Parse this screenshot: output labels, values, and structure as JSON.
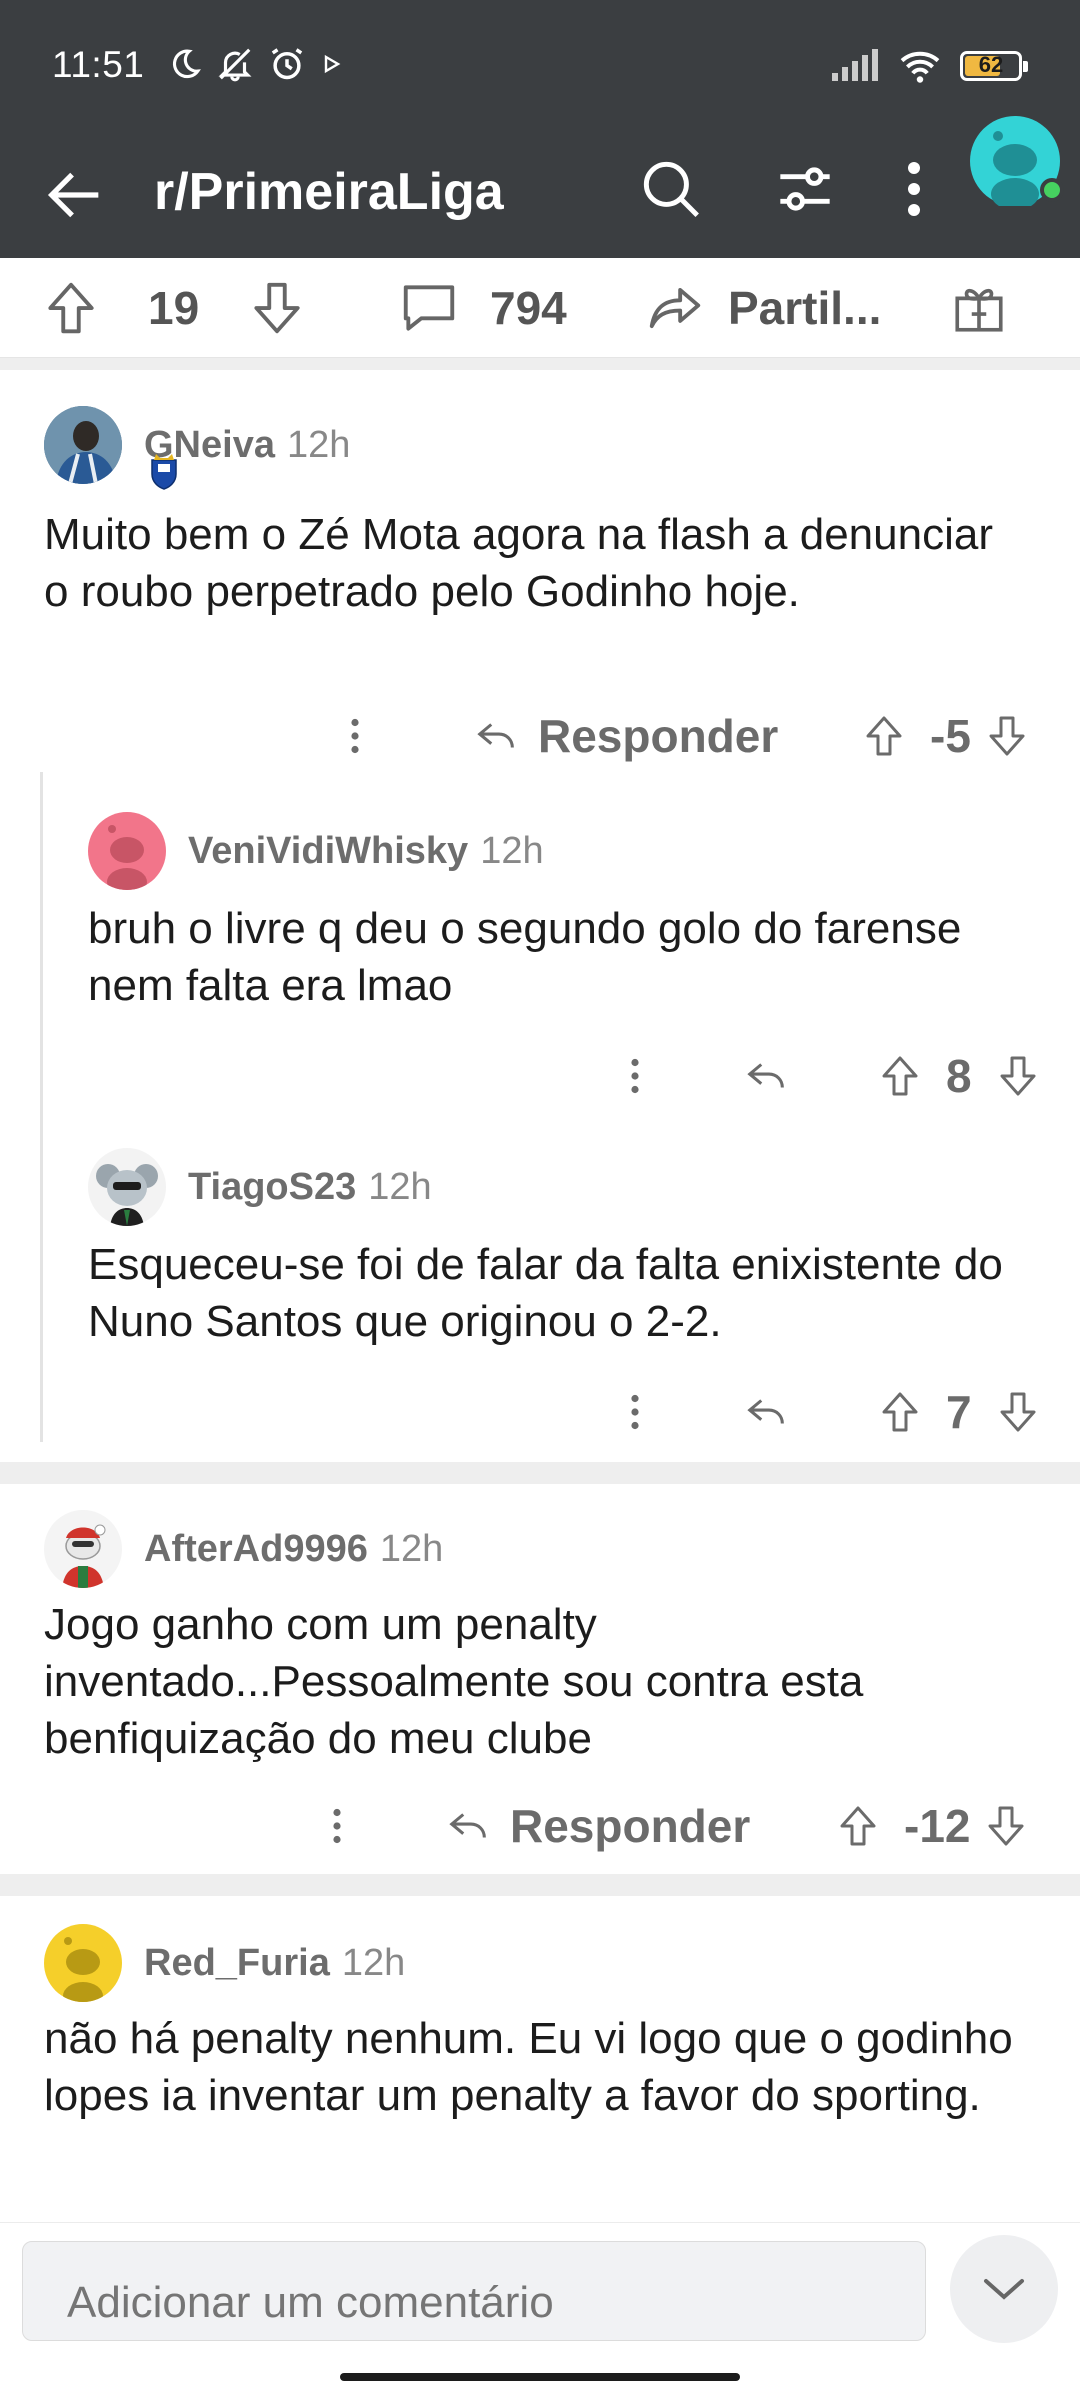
{
  "status_bar": {
    "time": "11:51",
    "battery_level": "62",
    "icons": [
      "moon-icon",
      "bell-off-icon",
      "alarm-icon",
      "play-icon",
      "signal-icon",
      "wifi-icon",
      "battery-icon"
    ]
  },
  "app_bar": {
    "title": "r/PrimeiraLiga",
    "icons": [
      "back-arrow-icon",
      "search-icon",
      "filters-icon",
      "more-vertical-icon",
      "avatar"
    ]
  },
  "action_bar": {
    "votes": "19",
    "comments": "794",
    "share_label": "Partil..."
  },
  "comments": [
    {
      "user": "GNeiva",
      "time": "12h",
      "text": "Muito bem o Zé Mota agora na flash a denunciar o roubo perpetrado pelo Godinho hoje.",
      "reply_label": "Responder",
      "score": "-5"
    },
    {
      "user": "VeniVidiWhisky",
      "time": "12h",
      "text": "bruh o livre q deu o segundo golo do farense nem falta era lmao",
      "score": "8"
    },
    {
      "user": "TiagoS23",
      "time": "12h",
      "text": "Esqueceu-se foi de falar da falta enixistente do Nuno Santos que originou o 2-2.",
      "score": "7"
    },
    {
      "user": "AfterAd9996",
      "time": "12h",
      "text": "Jogo ganho com um penalty inventado...Pessoalmente sou contra esta benfiquização do meu clube",
      "reply_label": "Responder",
      "score": "-12"
    },
    {
      "user": "Red_Furia",
      "time": "12h",
      "text": "não há penalty nenhum. Eu vi logo que o godinho lopes ia inventar um penalty a favor do sporting."
    }
  ],
  "composer": {
    "placeholder": "Adicionar um comentário"
  },
  "colors": {
    "top_bar": "#3b3e41",
    "avatar_teal": "#33d3d6",
    "online_green": "#46d160",
    "battery_yellow": "#f0b841"
  }
}
